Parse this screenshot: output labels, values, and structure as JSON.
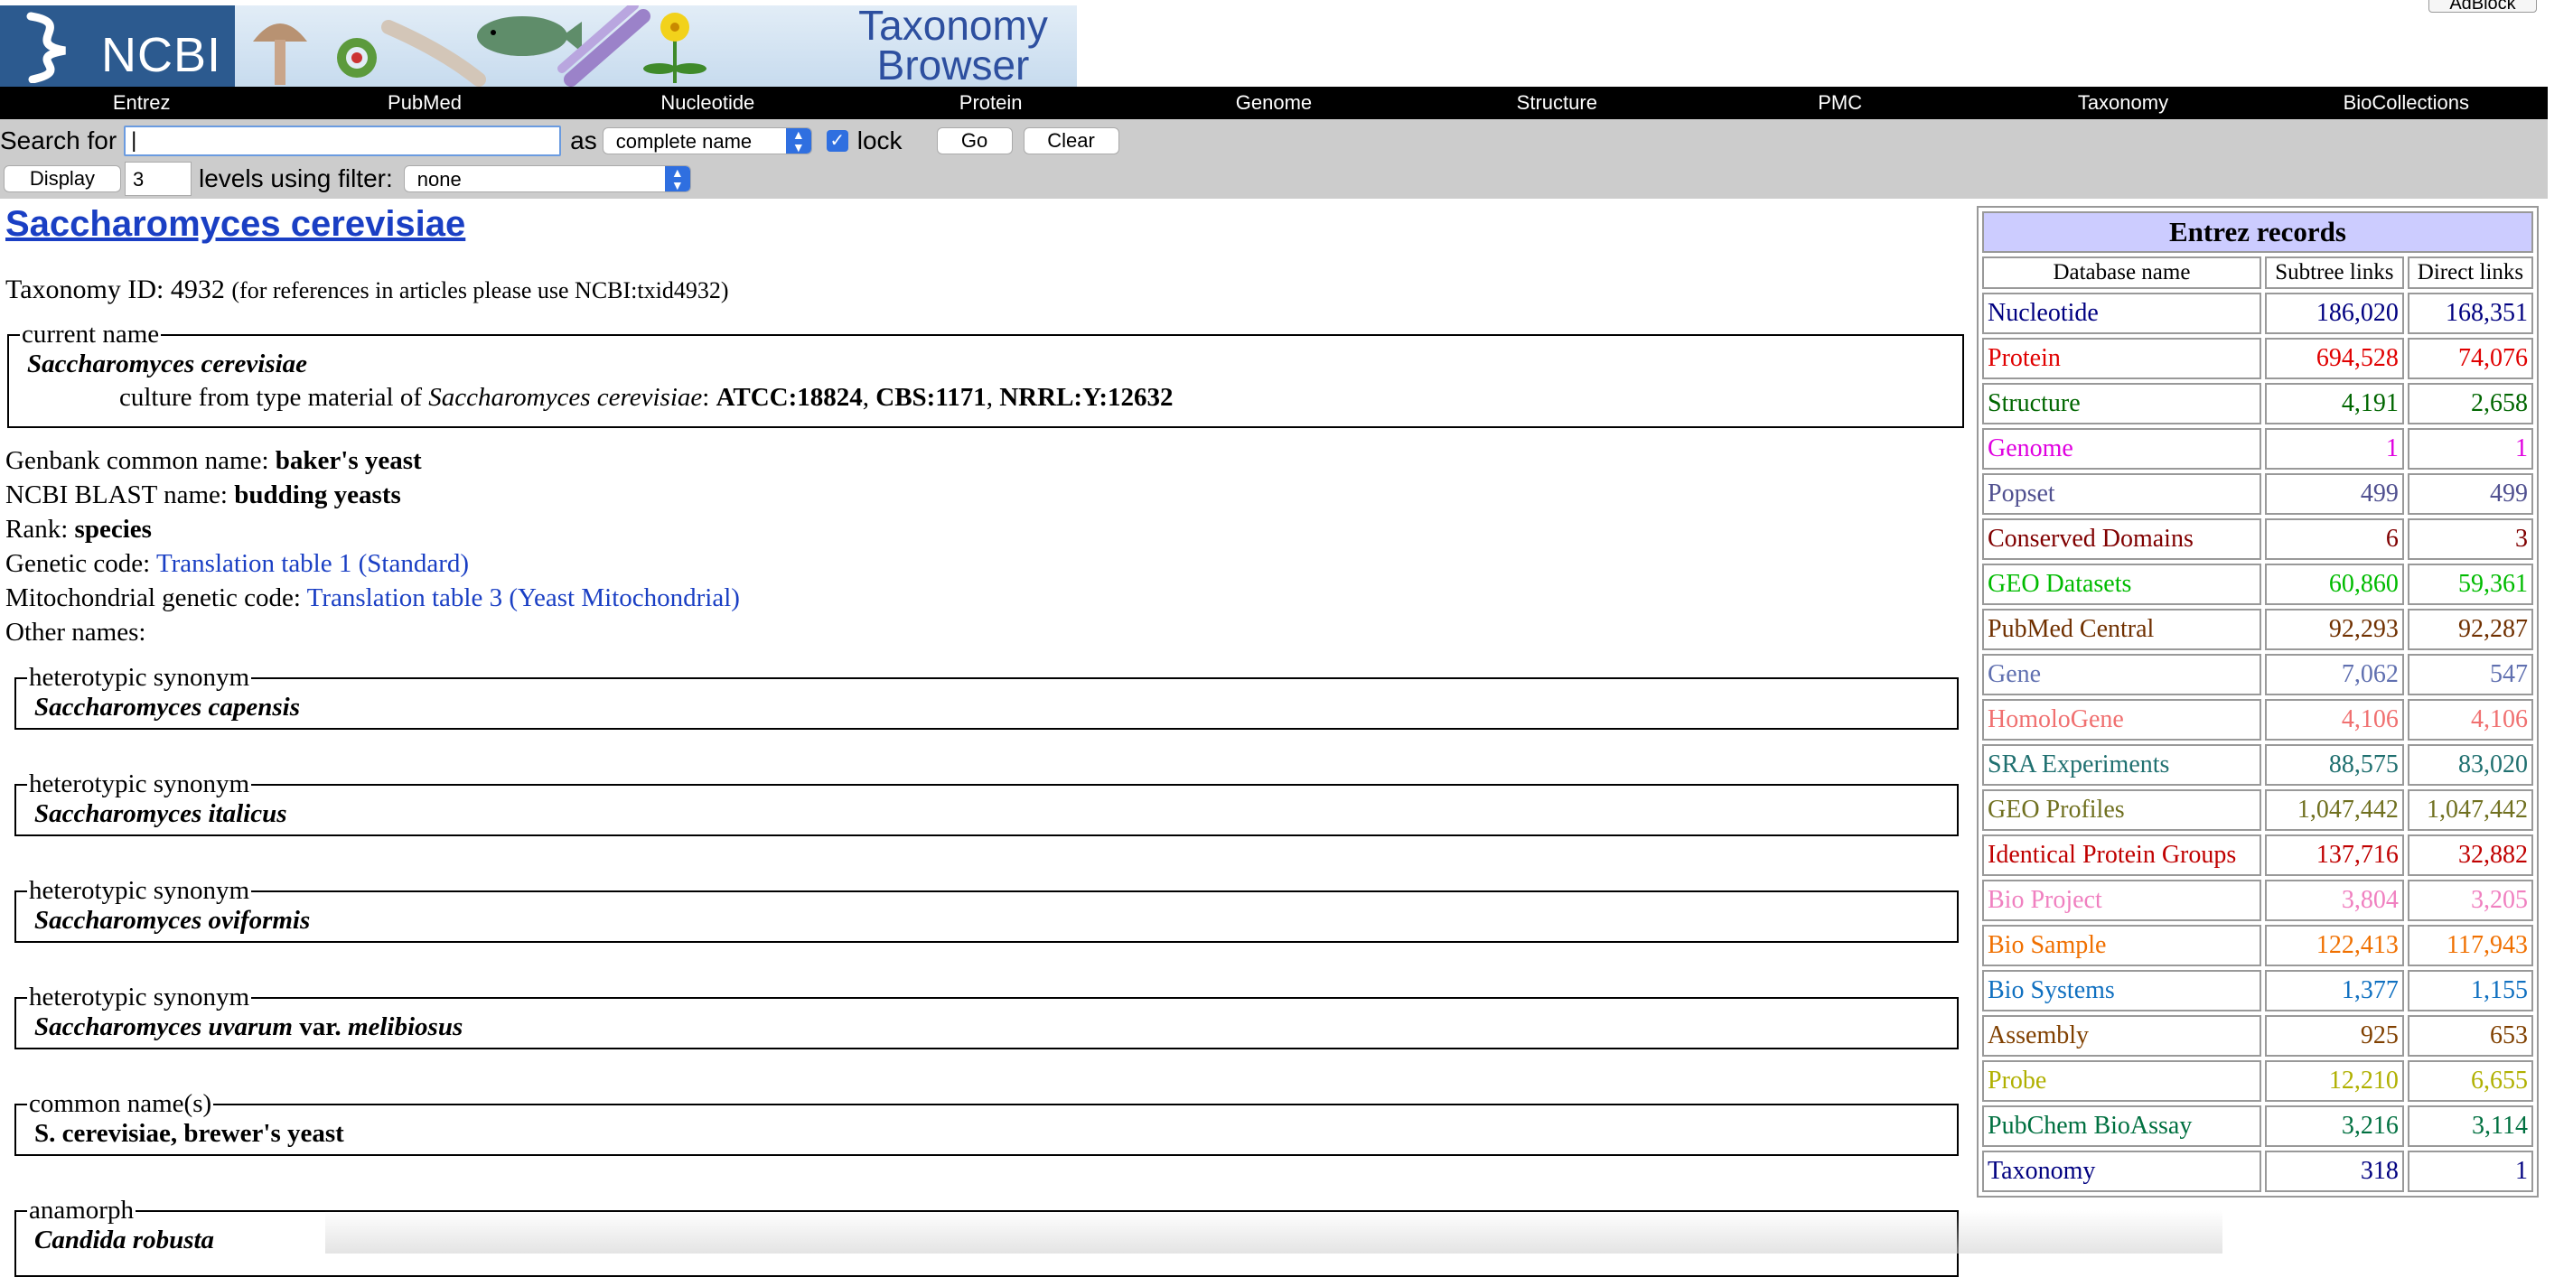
{
  "header": {
    "logo_text": "NCBI",
    "banner_title_line1": "Taxonomy",
    "banner_title_line2": "Browser",
    "adblock_label": "AdBlock"
  },
  "nav": [
    "Entrez",
    "PubMed",
    "Nucleotide",
    "Protein",
    "Genome",
    "Structure",
    "PMC",
    "Taxonomy",
    "BioCollections"
  ],
  "search": {
    "search_for_label": "Search for",
    "search_value": "|",
    "as_label": "as",
    "type_selected": "complete name",
    "lock_label": "lock",
    "lock_checked": true,
    "go_label": "Go",
    "clear_label": "Clear",
    "display_label": "Display",
    "levels_value": "3",
    "levels_label": "levels using filter:",
    "filter_selected": "none"
  },
  "taxon": {
    "name": "Saccharomyces cerevisiae",
    "taxid_label": "Taxonomy ID: 4932",
    "taxid_note": "(for references in articles please use NCBI:txid4932)",
    "current_name_legend": "current name",
    "current_name": "Saccharomyces cerevisiae",
    "culture_prefix": "culture from type material of ",
    "culture_species": "Saccharomyces cerevisiae",
    "culture_colon": ": ",
    "culture_strains": [
      {
        "text": "ATCC:18824",
        "sep": ", "
      },
      {
        "text": "CBS:1171",
        "sep": ", "
      },
      {
        "text": "NRRL:Y:12632",
        "sep": ""
      }
    ],
    "genbank_common_label": "Genbank common name: ",
    "genbank_common_value": "baker's yeast",
    "blast_label": "NCBI BLAST name: ",
    "blast_value": "budding yeasts",
    "rank_label": "Rank: ",
    "rank_value": "species",
    "genetic_code_label": "Genetic code: ",
    "genetic_code_link": "Translation table 1 (Standard)",
    "mito_code_label": "Mitochondrial genetic code: ",
    "mito_code_link": "Translation table 3 (Yeast Mitochondrial)",
    "other_names_label": "Other names:"
  },
  "other_names": [
    {
      "legend": "heterotypic synonym",
      "name": "Saccharomyces capensis"
    },
    {
      "legend": "heterotypic synonym",
      "name": "Saccharomyces italicus"
    },
    {
      "legend": "heterotypic synonym",
      "name": "Saccharomyces oviformis"
    },
    {
      "legend": "heterotypic synonym",
      "name_a": "Saccharomyces uvarum",
      "name_var": "var.",
      "name_b": "melibiosus"
    },
    {
      "legend": "common name(s)",
      "name_c1": "S. cerevisiae",
      "name_c2": "brewer's yeast"
    },
    {
      "legend": "anamorph",
      "name": "Candida robusta"
    }
  ],
  "records": {
    "title": "Entrez records",
    "col_db": "Database name",
    "col_subtree": "Subtree links",
    "col_direct": "Direct links",
    "rows": [
      {
        "db": "Nucleotide",
        "subtree": "186,020",
        "direct": "168,351",
        "color": "#000080"
      },
      {
        "db": "Protein",
        "subtree": "694,528",
        "direct": "74,076",
        "color": "#e00000"
      },
      {
        "db": "Structure",
        "subtree": "4,191",
        "direct": "2,658",
        "color": "#006600"
      },
      {
        "db": "Genome",
        "subtree": "1",
        "direct": "1",
        "color": "#e000e0"
      },
      {
        "db": "Popset",
        "subtree": "499",
        "direct": "499",
        "color": "#505090"
      },
      {
        "db": "Conserved Domains",
        "subtree": "6",
        "direct": "3",
        "color": "#800000"
      },
      {
        "db": "GEO Datasets",
        "subtree": "60,860",
        "direct": "59,361",
        "color": "#00bb00"
      },
      {
        "db": "PubMed Central",
        "subtree": "92,293",
        "direct": "92,287",
        "color": "#703000"
      },
      {
        "db": "Gene",
        "subtree": "7,062",
        "direct": "547",
        "color": "#6070b0"
      },
      {
        "db": "HomoloGene",
        "subtree": "4,106",
        "direct": "4,106",
        "color": "#f07070"
      },
      {
        "db": "SRA Experiments",
        "subtree": "88,575",
        "direct": "83,020",
        "color": "#207070"
      },
      {
        "db": "GEO Profiles",
        "subtree": "1,047,442",
        "direct": "1,047,442",
        "color": "#707020"
      },
      {
        "db": "Identical Protein Groups",
        "subtree": "137,716",
        "direct": "32,882",
        "color": "#c00000"
      },
      {
        "db": "Bio Project",
        "subtree": "3,804",
        "direct": "3,205",
        "color": "#f080c0"
      },
      {
        "db": "Bio Sample",
        "subtree": "122,413",
        "direct": "117,943",
        "color": "#f07000"
      },
      {
        "db": "Bio Systems",
        "subtree": "1,377",
        "direct": "1,155",
        "color": "#1070c0"
      },
      {
        "db": "Assembly",
        "subtree": "925",
        "direct": "653",
        "color": "#804000"
      },
      {
        "db": "Probe",
        "subtree": "12,210",
        "direct": "6,655",
        "color": "#b0b000"
      },
      {
        "db": "PubChem BioAssay",
        "subtree": "3,216",
        "direct": "3,114",
        "color": "#007040"
      },
      {
        "db": "Taxonomy",
        "subtree": "318",
        "direct": "1",
        "color": "#000080"
      }
    ]
  }
}
